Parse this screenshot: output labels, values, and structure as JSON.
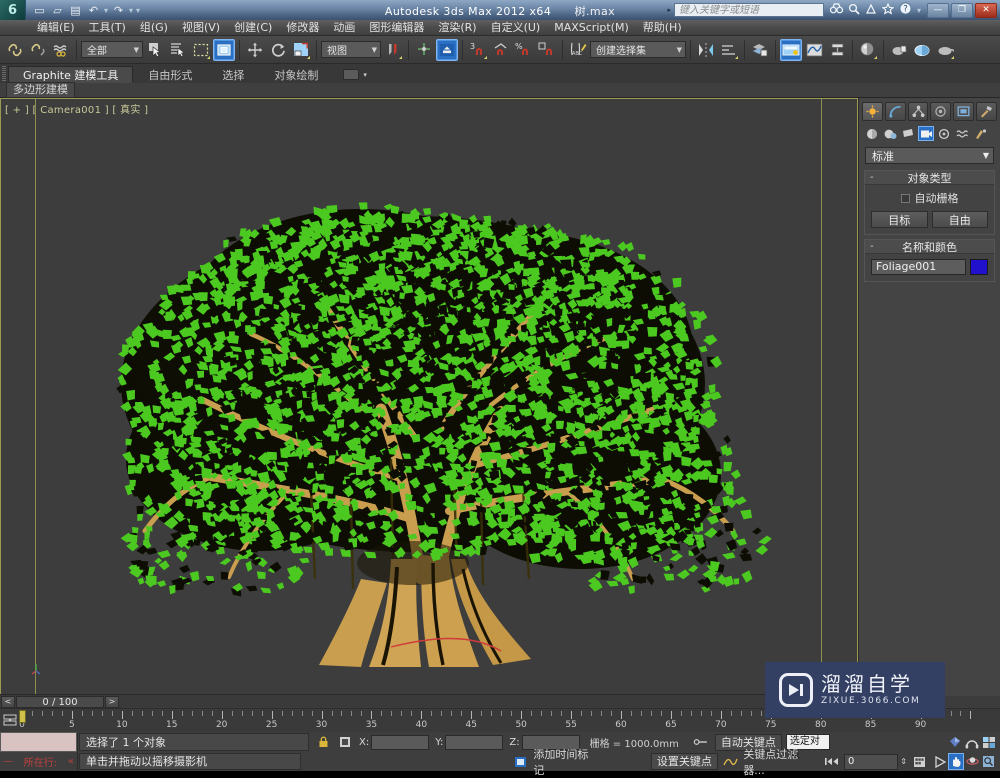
{
  "window": {
    "app_title": "Autodesk 3ds Max  2012 x64",
    "file_name": "树.max",
    "logo_glyph": "6",
    "quick_access": [
      {
        "name": "new-file-icon",
        "glyph": "▭"
      },
      {
        "name": "open-file-icon",
        "glyph": "▱"
      },
      {
        "name": "save-file-icon",
        "glyph": "▤"
      },
      {
        "name": "undo-icon",
        "glyph": "↶"
      },
      {
        "name": "undo-dropdown-icon",
        "glyph": "▾"
      },
      {
        "name": "redo-icon",
        "glyph": "↷"
      },
      {
        "name": "redo-dropdown-icon",
        "glyph": "▾"
      },
      {
        "name": "qat-customize-icon",
        "glyph": "▾"
      }
    ],
    "search_placeholder": "键入关键字或短语",
    "help_icons": [
      {
        "name": "binoculars-icon",
        "glyph": "👓"
      },
      {
        "name": "magnifier-icon",
        "glyph": "🔍"
      },
      {
        "name": "info-center-icon",
        "glyph": "⛶"
      },
      {
        "name": "favorites-star-icon",
        "glyph": "☆"
      },
      {
        "name": "help-icon",
        "glyph": "?"
      },
      {
        "name": "help-dropdown-icon",
        "glyph": "▾"
      }
    ],
    "controls": [
      {
        "name": "minimize-button",
        "glyph": "—"
      },
      {
        "name": "maximize-button",
        "glyph": "❐"
      },
      {
        "name": "close-button",
        "glyph": "✕"
      }
    ]
  },
  "menu": {
    "items": [
      "编辑(E)",
      "工具(T)",
      "组(G)",
      "视图(V)",
      "创建(C)",
      "修改器",
      "动画",
      "图形编辑器",
      "渲染(R)",
      "自定义(U)",
      "MAXScript(M)",
      "帮助(H)"
    ]
  },
  "toolbar": {
    "selection_filter": "全部",
    "reference_coord": "视图",
    "named_selection_set": "创建选择集",
    "buttons": [
      {
        "name": "select-and-link-icon",
        "glyph": "⛓"
      },
      {
        "name": "unlink-selection-icon",
        "glyph": "⛓"
      },
      {
        "name": "bind-to-space-warp-icon",
        "glyph": "≈"
      },
      {
        "name": "select-object-icon",
        "glyph": "⬚"
      },
      {
        "name": "select-by-name-icon",
        "glyph": "☰"
      },
      {
        "name": "rectangular-selection-region-icon",
        "glyph": "▢"
      },
      {
        "name": "window-crossing-icon",
        "glyph": "▣"
      },
      {
        "name": "select-and-move-icon",
        "glyph": "✥"
      },
      {
        "name": "select-and-rotate-icon",
        "glyph": "↻"
      },
      {
        "name": "select-and-scale-icon",
        "glyph": "⬈"
      },
      {
        "name": "use-center-flyout-icon",
        "glyph": "◈"
      },
      {
        "name": "snaps-toggle-icon",
        "glyph": "3"
      },
      {
        "name": "angle-snap-toggle-icon",
        "glyph": "∠"
      },
      {
        "name": "percent-snap-toggle-icon",
        "glyph": "%"
      },
      {
        "name": "spinner-snap-toggle-icon",
        "glyph": "⇕"
      },
      {
        "name": "edit-named-selection-sets-icon",
        "glyph": "✎"
      },
      {
        "name": "mirror-icon",
        "glyph": "Ⅵ"
      },
      {
        "name": "align-icon",
        "glyph": "▤"
      },
      {
        "name": "layer-manager-icon",
        "glyph": "▰"
      },
      {
        "name": "toggle-ribbon-icon",
        "glyph": "▤"
      },
      {
        "name": "curve-editor-icon",
        "glyph": "∿"
      },
      {
        "name": "schematic-view-icon",
        "glyph": "⊞"
      },
      {
        "name": "material-editor-icon",
        "glyph": "◍"
      },
      {
        "name": "render-setup-icon",
        "glyph": "☕"
      },
      {
        "name": "rendered-frame-window-icon",
        "glyph": "◐"
      },
      {
        "name": "render-production-icon",
        "glyph": "☕"
      }
    ]
  },
  "ribbon": {
    "tabs": [
      "Graphite 建模工具",
      "自由形式",
      "选择",
      "对象绘制"
    ],
    "active_tab": "Graphite 建模工具",
    "panel_icon": "⬛",
    "panel_caret": "▾",
    "subtab": "多边形建模"
  },
  "viewport": {
    "label": "[ + ] [ Camera001 ] [ 真实 ]",
    "background": "#3d3d3d",
    "border_color": "#9a9a52",
    "leaf_color": "#4cc920",
    "leaf_dark_color": "#0d0d03",
    "trunk_color": "#d0a455",
    "trunk_shadow_color": "#141406"
  },
  "command_panel": {
    "tabs": [
      {
        "name": "create-tab",
        "glyph": "✳"
      },
      {
        "name": "modify-tab",
        "glyph": "⌒"
      },
      {
        "name": "hierarchy-tab",
        "glyph": "⚯"
      },
      {
        "name": "motion-tab",
        "glyph": "◎"
      },
      {
        "name": "display-tab",
        "glyph": "▣"
      },
      {
        "name": "utilities-tab",
        "glyph": "🔨"
      }
    ],
    "object_categories": [
      {
        "name": "geometry-category-icon",
        "glyph": "●"
      },
      {
        "name": "shapes-category-icon",
        "glyph": "◗"
      },
      {
        "name": "lights-category-icon",
        "glyph": "◣"
      },
      {
        "name": "cameras-category-icon",
        "glyph": "▩"
      },
      {
        "name": "helpers-category-icon",
        "glyph": "◉"
      },
      {
        "name": "space-warps-category-icon",
        "glyph": "≈"
      },
      {
        "name": "systems-category-icon",
        "glyph": "➤"
      }
    ],
    "category_dropdown": "标准",
    "rollouts": [
      {
        "title": "对象类型",
        "minus": "-",
        "autogrid_label": "自动栅格",
        "buttons": [
          "目标",
          "自由"
        ]
      },
      {
        "title": "名称和颜色",
        "minus": "-",
        "object_name": "Foliage001",
        "object_color": "#2211cc"
      }
    ]
  },
  "timeline": {
    "prev_frame": "<",
    "next_frame": ">",
    "frame_display": "0 / 100",
    "key_mode_icon": "⊟",
    "tick_labels": [
      "0",
      "5",
      "10",
      "15",
      "20",
      "25",
      "30",
      "35",
      "40",
      "45",
      "50",
      "55",
      "60",
      "65",
      "70",
      "75",
      "80",
      "85",
      "90"
    ],
    "current_frame": 0,
    "range_start": 0,
    "range_end": 100
  },
  "status_bar": {
    "maxscript_prompt": "所在行:",
    "maxscript_caret": "«",
    "maxscript_minus": "—",
    "selection_status": "选择了 1 个对象",
    "prompt_text": "单击并拖动以摇移摄影机",
    "lock_icon": "🔒",
    "absolute_mode_icon": "⊡",
    "coords": [
      {
        "label": "X:",
        "value": ""
      },
      {
        "label": "Y:",
        "value": ""
      },
      {
        "label": "Z:",
        "value": ""
      }
    ],
    "grid_text": "栅格 = 1000.0mm",
    "add_time_tag": "添加时间标记",
    "add_time_tag_icon": "▣",
    "auto_key_label": "自动关键点",
    "set_key_label": "设置关键点",
    "key_toggle_icon": "⚊o",
    "selected_object_filter": "选定对象",
    "key_filters_label": "关键点过滤器...",
    "key_curve_icon": "∿",
    "frame_spinner_icon": "⏭",
    "frame_value": "0",
    "time_config_icon": "▦",
    "play_icon": "▷",
    "nav_buttons_top": [
      {
        "name": "zoom-extents-all-icon",
        "glyph": "◈"
      },
      {
        "name": "field-of-view-icon",
        "glyph": "◠"
      },
      {
        "name": "maximize-viewport-toggle-icon",
        "glyph": "⊞"
      }
    ],
    "nav_buttons_bottom": [
      {
        "name": "pan-view-icon",
        "glyph": "✋"
      },
      {
        "name": "orbit-icon",
        "glyph": "◉"
      },
      {
        "name": "zoom-region-icon",
        "glyph": "🔍"
      }
    ]
  },
  "watermark": {
    "title": "溜溜自学",
    "url": "ZIXUE.3066.COM"
  }
}
